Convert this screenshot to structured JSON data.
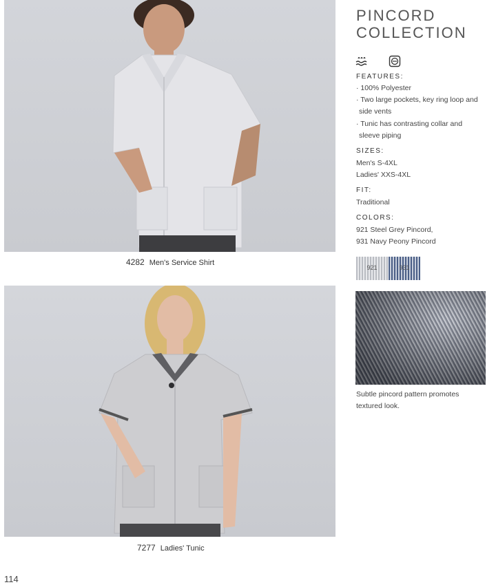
{
  "title_line1": "PINCORD",
  "title_line2": "COLLECTION",
  "care_icons": [
    "wash-30-icon",
    "tumble-dry-icon"
  ],
  "features": {
    "label": "FEATURES:",
    "items": [
      "· 100% Polyester",
      "· Two large pockets, key ring loop and",
      "side vents",
      "· Tunic has contrasting collar and",
      "sleeve piping"
    ]
  },
  "sizes": {
    "label": "SIZES:",
    "items": [
      "Men's S-4XL",
      "Ladies' XXS-4XL"
    ]
  },
  "fit": {
    "label": "FIT:",
    "items": [
      "Traditional"
    ]
  },
  "colors": {
    "label": "COLORS:",
    "items": [
      "921 Steel Grey Pincord,",
      "931 Navy Peony Pincord"
    ],
    "swatches": [
      {
        "code": "921",
        "color": "#b9bcc2"
      },
      {
        "code": "931",
        "color": "#4a5e86"
      }
    ]
  },
  "fabric_caption": [
    "Subtle pincord pattern promotes",
    "textured look."
  ],
  "products": [
    {
      "number": "4282",
      "name": "Men's Service Shirt"
    },
    {
      "number": "7277",
      "name": "Ladies' Tunic"
    }
  ],
  "page_number": "114"
}
